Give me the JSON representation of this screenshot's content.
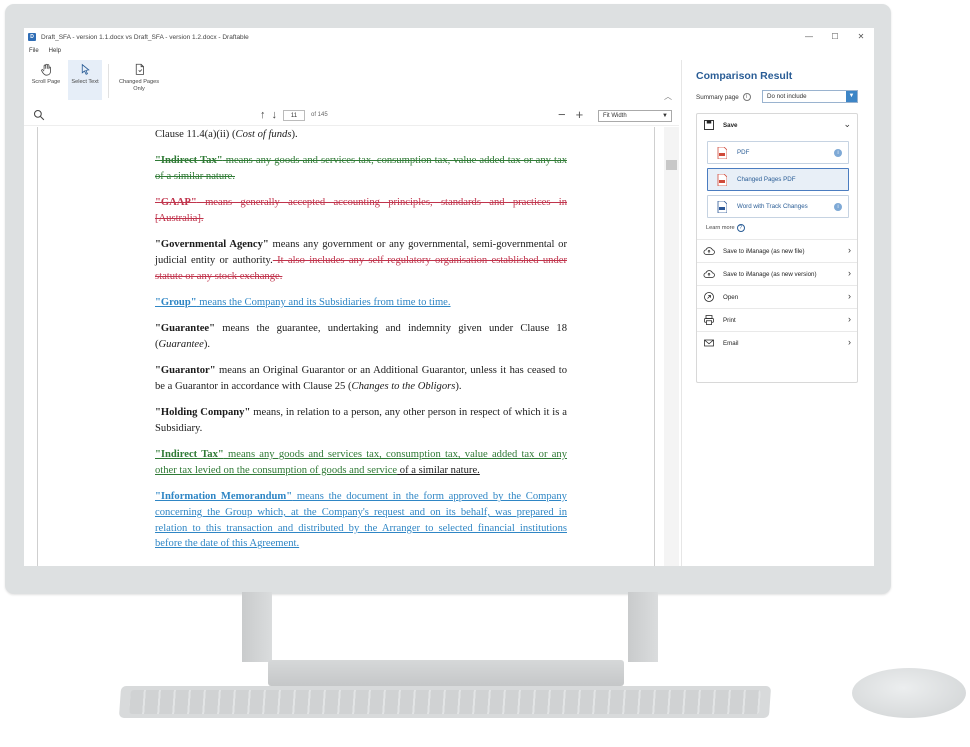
{
  "window": {
    "title": "Draft_SFA - version 1.1.docx vs Draft_SFA - version 1.2.docx - Draftable",
    "controls": {
      "minimize": "—",
      "maximize": "☐",
      "close": "✕"
    }
  },
  "menu": {
    "file": "File",
    "help": "Help"
  },
  "ribbon": {
    "scroll_page": "Scroll Page",
    "select_text": "Select Text",
    "changed_pages_only": "Changed Pages Only"
  },
  "toolbar": {
    "page_current": "11",
    "page_total": "of 145",
    "zoom_value": "Fit Width"
  },
  "document": {
    "p0": "Clause 11.4(a)(ii) (",
    "p0_italic": "Cost of funds",
    "p0_end": ").",
    "p1_term": "\"Indirect Tax\"",
    "p1_text": " means any goods and services tax, consumption tax, value added tax or any tax of a similar nature.",
    "p2_term": "\"GAAP\"",
    "p2_text": " means generally accepted accounting principles, standards and practices in [Australia].",
    "p3_term": "\"Governmental Agency\"",
    "p3_text": " means any government or any governmental, semi-governmental or judicial entity or authority.",
    "p3_del": " It also includes any self-regulatory organisation established under statute or any stock exchange.",
    "p4_term": "\"Group\"",
    "p4_text": " means the Company and its Subsidiaries from time to time.",
    "p5_term": "\"Guarantee\"",
    "p5_text": " means the guarantee, undertaking and indemnity given under Clause 18 (",
    "p5_italic": "Guarantee",
    "p5_end": ").",
    "p6_term": "\"Guarantor\"",
    "p6_text": " means an Original Guarantor or an Additional Guarantor, unless it has ceased to be a Guarantor in accordance with Clause 25 (",
    "p6_italic": "Changes to the Obligors",
    "p6_end": ").",
    "p7_term": "\"Holding Company\"",
    "p7_text": " means, in relation to a person, any other person in respect of which it is a Subsidiary.",
    "p8_term": "\"Indirect Tax\"",
    "p8_text": " means any goods and services tax, consumption tax, value added tax or any other tax levied on the consumption of goods and service",
    "p8_end": " of a similar nature.",
    "p9_term": "\"Information Memorandum\"",
    "p9_text": " means the document in the form approved by the Company concerning the Group which, at the Company's request and on its behalf, was prepared in relation to this transaction and distributed by the Arranger to selected financial institutions before the date of this Agreement."
  },
  "panel": {
    "title": "Comparison Result",
    "summary_label": "Summary page",
    "summary_value": "Do not include",
    "save_label": "Save",
    "pdf_label": "PDF",
    "changed_pdf_label": "Changed Pages PDF",
    "word_label": "Word with Track Changes",
    "learn_more": "Learn more",
    "imanage_new_file": "Save to iManage (as new file)",
    "imanage_new_version": "Save to iManage (as new version)",
    "open_label": "Open",
    "print_label": "Print",
    "email_label": "Email"
  },
  "colors": {
    "accent": "#2a5d96",
    "deleted": "#c0344c",
    "moved": "#2f7a35",
    "inserted": "#2f86c5"
  }
}
